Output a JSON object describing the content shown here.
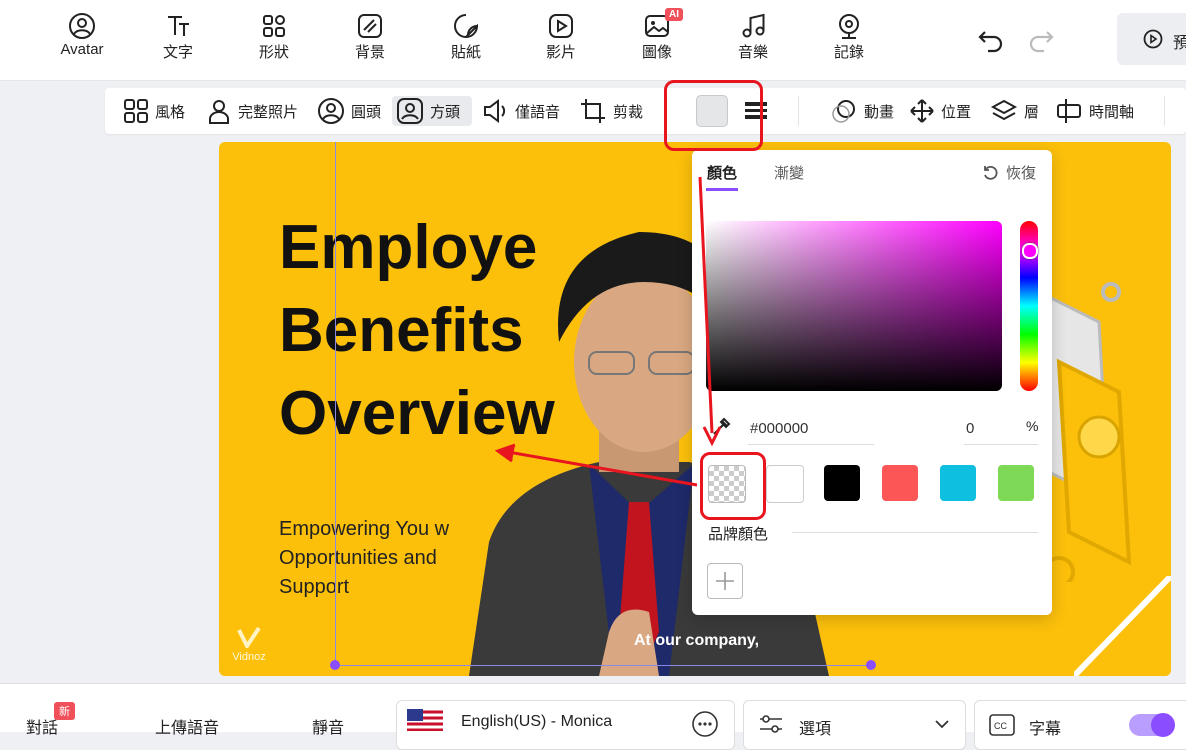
{
  "toolbar": {
    "tools": [
      "Avatar",
      "文字",
      "形狀",
      "背景",
      "貼紙",
      "影片",
      "圖像",
      "音樂",
      "記錄"
    ],
    "ai_badge": "AI",
    "preview_label": "預"
  },
  "subbar": {
    "style": "風格",
    "full_photo": "完整照片",
    "round_head": "圓頭",
    "square_head": "方頭",
    "voice_only": "僅語音",
    "crop": "剪裁",
    "animation": "動畫",
    "position": "位置",
    "layer": "層",
    "timeline": "時間軸"
  },
  "slide": {
    "title": "Employe\nBenefits\nOverview",
    "subtitle": "Empowering You w\nOpportunities and\nSupport",
    "caption": "At our company,",
    "brand": "Vidnoz"
  },
  "color_popup": {
    "tab_color": "顏色",
    "tab_gradient": "漸變",
    "reset": "恢復",
    "hex_value": "#000000",
    "opacity_value": "0",
    "opacity_unit": "%",
    "brand_colors_label": "品牌顏色",
    "swatches": [
      "transparent",
      "#ffffff",
      "#000000",
      "#fc5656",
      "#0ebfdf",
      "#7ed957"
    ]
  },
  "bottom": {
    "dialog": "對話",
    "new_badge": "新",
    "upload_audio": "上傳語音",
    "mute": "靜音",
    "voice": "English(US) - Monica",
    "options": "選項",
    "subtitles": "字幕"
  },
  "colors": {
    "slide_bg": "#fcc00b",
    "accent_purple": "#8a4dff",
    "annotation_red": "#e8141e"
  }
}
